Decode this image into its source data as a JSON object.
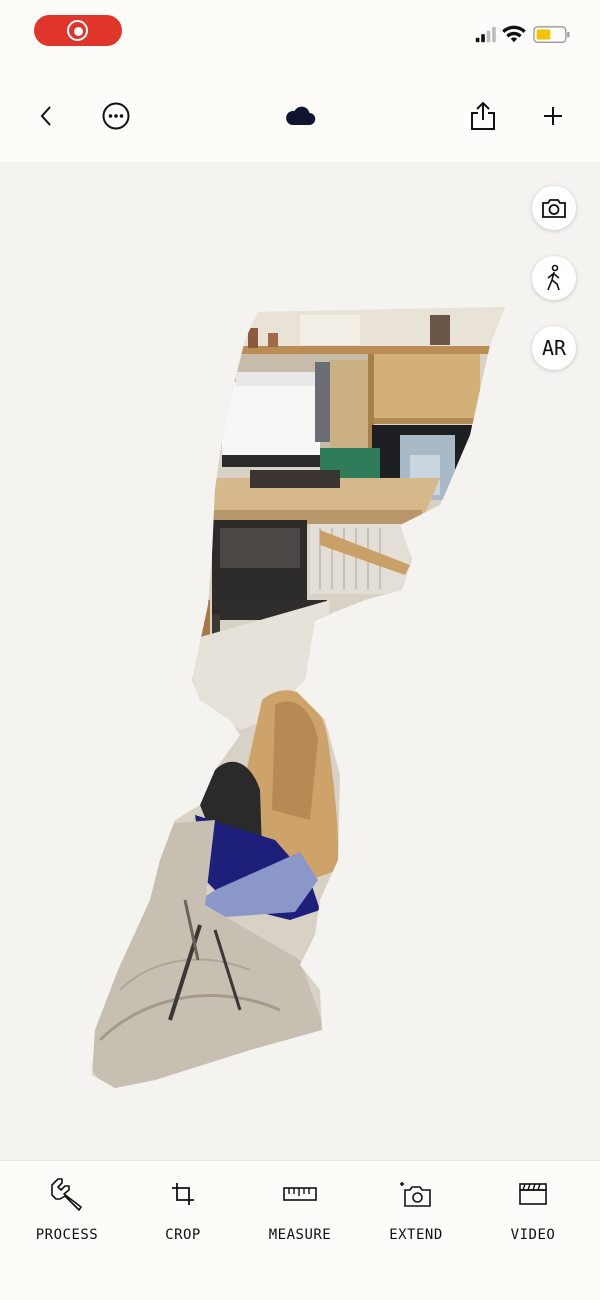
{
  "status_bar": {
    "recording_indicator": "record-icon",
    "icons": [
      "cellular-signal-icon",
      "wifi-icon",
      "battery-icon"
    ],
    "battery_color": "#f5c400"
  },
  "top_bar": {
    "back_icon": "chevron-left-icon",
    "more_icon": "more-options-icon",
    "cloud_icon": "cloud-icon",
    "share_icon": "share-icon",
    "add_icon": "plus-icon"
  },
  "viewer": {
    "background": "#f4f3ef",
    "side_buttons": {
      "camera_icon": "camera-icon",
      "walk_icon": "walk-icon",
      "ar_label": "AR"
    }
  },
  "toolbar": {
    "items": [
      {
        "label": "PROCESS",
        "icon": "wrench-icon"
      },
      {
        "label": "CROP",
        "icon": "crop-icon"
      },
      {
        "label": "MEASURE",
        "icon": "ruler-icon"
      },
      {
        "label": "EXTEND",
        "icon": "add-camera-icon"
      },
      {
        "label": "VIDEO",
        "icon": "clapperboard-icon"
      }
    ]
  },
  "colors": {
    "record_red": "#e0352b",
    "background": "#fdfcf9"
  }
}
